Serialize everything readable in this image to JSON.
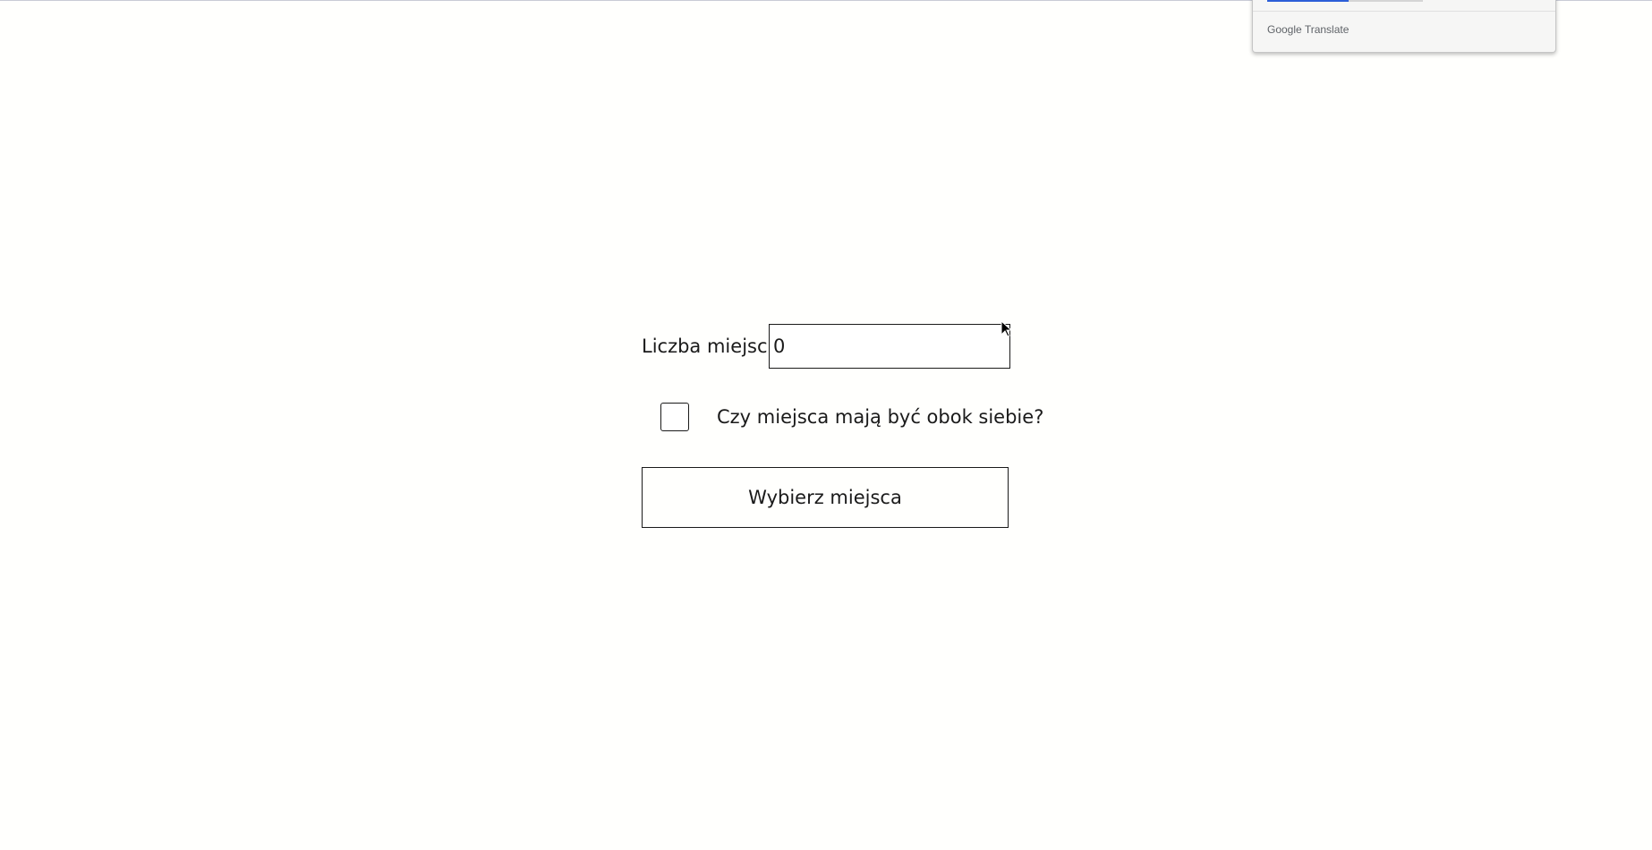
{
  "translate_popup": {
    "brand": "Google",
    "product": "Translate"
  },
  "form": {
    "count_label": "Liczba miejsc:",
    "count_value": "0",
    "adjacent_label": "Czy miejsca mają być obok siebie?",
    "adjacent_checked": false,
    "submit_label": "Wybierz miejsca"
  }
}
